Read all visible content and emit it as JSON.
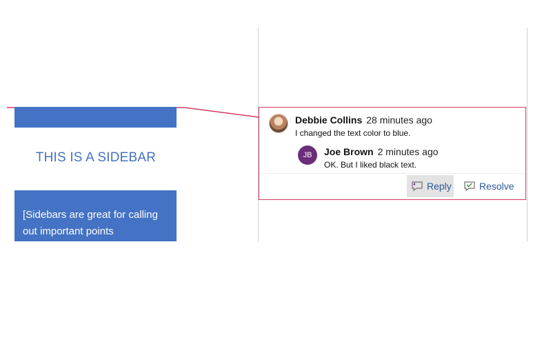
{
  "document": {
    "sidebar_heading": "THIS IS A SIDEBAR",
    "sidebar_body": "[Sidebars are great for calling out important points"
  },
  "comment_thread": {
    "main": {
      "author": "Debbie Collins",
      "time": "28 minutes ago",
      "text": "I changed the text color to blue."
    },
    "reply": {
      "initials": "JB",
      "author": "Joe Brown",
      "time": "2 minutes ago",
      "text": "OK.  But I liked black text."
    },
    "actions": {
      "reply_label": "Reply",
      "resolve_label": "Resolve"
    }
  },
  "colors": {
    "accent_blue": "#4472c4",
    "comment_border": "#d23c63",
    "avatar_purple": "#6b2d7a",
    "action_text": "#2b5797"
  }
}
